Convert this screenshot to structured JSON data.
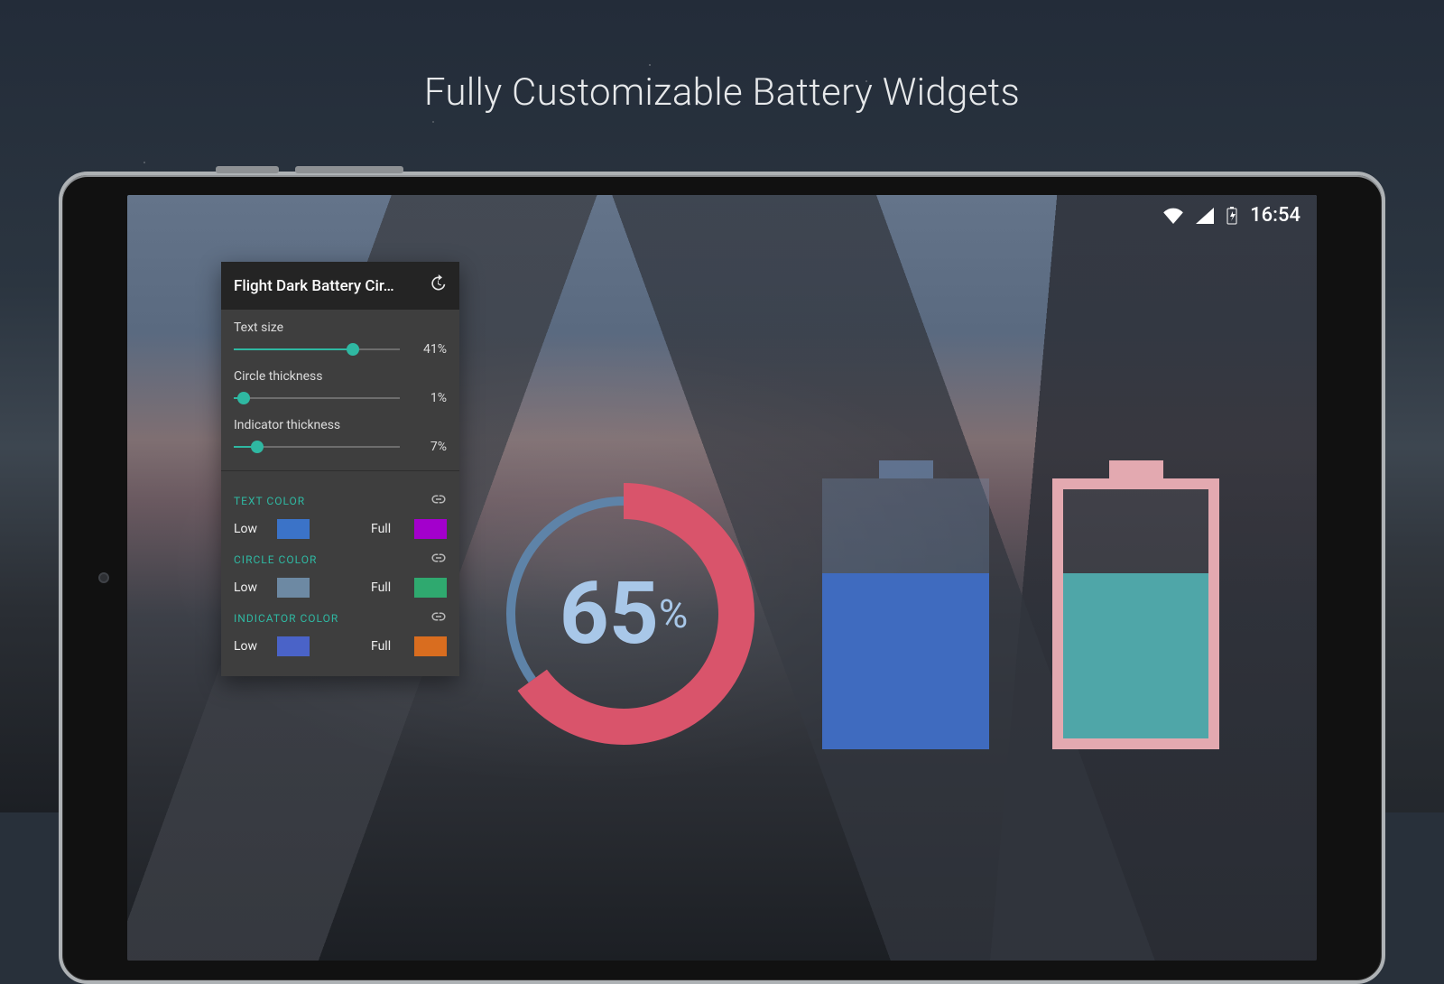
{
  "hero": {
    "title": "Fully Customizable Battery Widgets"
  },
  "status": {
    "time": "16:54"
  },
  "panel": {
    "title": "Flight Dark Battery Cir…",
    "sliders": [
      {
        "label": "Text size",
        "value": "41%",
        "pct": 72
      },
      {
        "label": "Circle thickness",
        "value": "1%",
        "pct": 6
      },
      {
        "label": "Indicator thickness",
        "value": "7%",
        "pct": 14
      }
    ],
    "groups": [
      {
        "heading": "TEXT COLOR",
        "low_label": "Low",
        "full_label": "Full",
        "low": "#3b73c8",
        "full": "#a300cc"
      },
      {
        "heading": "CIRCLE COLOR",
        "low_label": "Low",
        "full_label": "Full",
        "low": "#6d89a3",
        "full": "#2fa96f"
      },
      {
        "heading": "INDICATOR COLOR",
        "low_label": "Low",
        "full_label": "Full",
        "low": "#4a63c8",
        "full": "#d96d1f"
      }
    ]
  },
  "widgets": {
    "circle": {
      "value": "65",
      "suffix": "%",
      "pct": 65,
      "ring_color": "#d9546b",
      "track_color": "#5e83a8",
      "text_color": "#a8c7e8"
    },
    "battery1": {
      "pct": 65
    },
    "battery2": {
      "pct": 65
    }
  },
  "colors": {
    "accent": "#2fb8a2"
  }
}
